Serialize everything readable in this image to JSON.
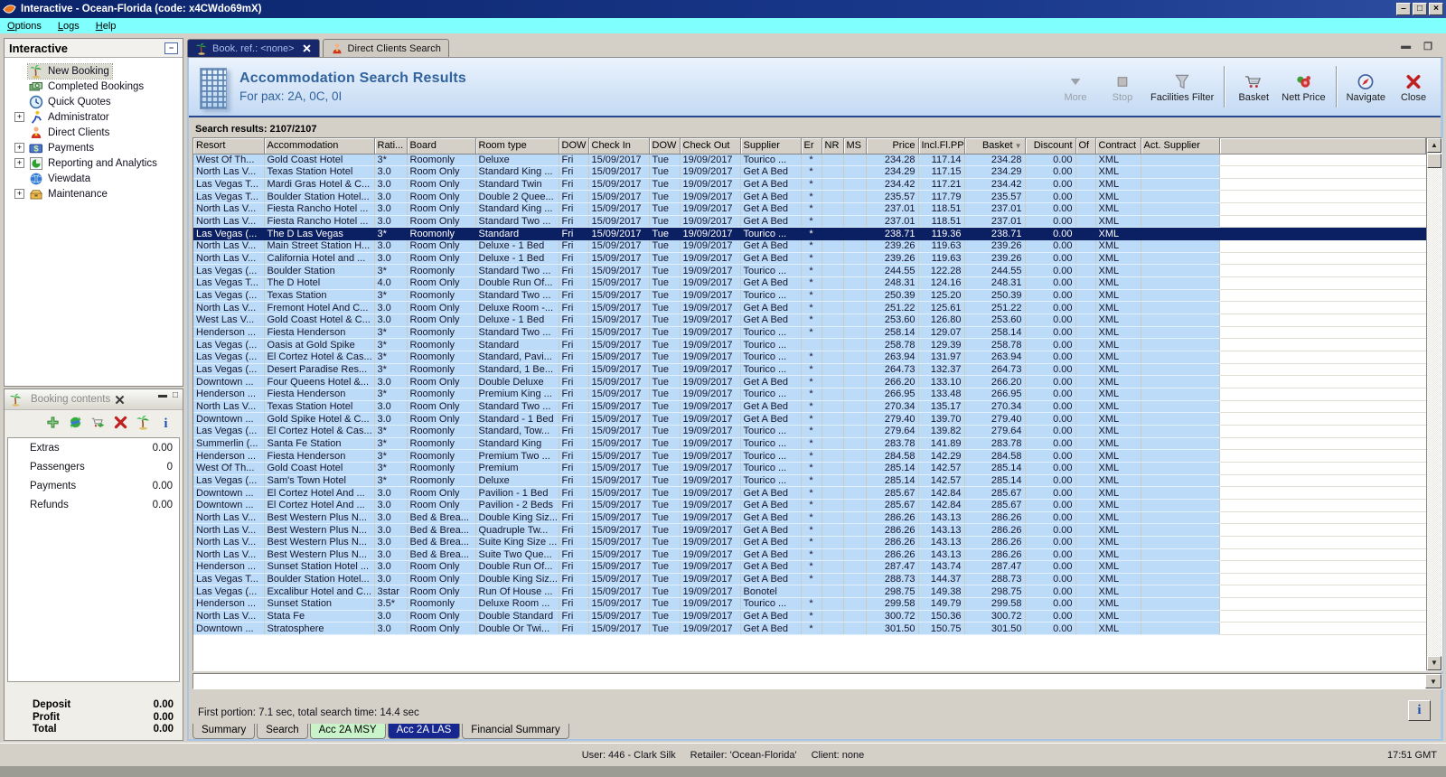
{
  "app": {
    "title": "Interactive - Ocean-Florida (code: x4CWdo69mX)",
    "window_buttons": [
      "minimize",
      "restore",
      "close"
    ]
  },
  "menu": {
    "items": [
      "Options",
      "Logs",
      "Help"
    ]
  },
  "sidebar": {
    "title": "Interactive",
    "collapse_icon": "collapse",
    "items": [
      {
        "label": "New Booking",
        "icon": "palm",
        "expander": false,
        "selected": true
      },
      {
        "label": "Completed Bookings",
        "icon": "money",
        "expander": false
      },
      {
        "label": "Quick Quotes",
        "icon": "clock",
        "expander": false
      },
      {
        "label": "Administrator",
        "icon": "runner",
        "expander": true
      },
      {
        "label": "Direct Clients",
        "icon": "person",
        "expander": false
      },
      {
        "label": "Payments",
        "icon": "payments",
        "expander": true
      },
      {
        "label": "Reporting and Analytics",
        "icon": "report",
        "expander": true
      },
      {
        "label": "Viewdata",
        "icon": "globe",
        "expander": false
      },
      {
        "label": "Maintenance",
        "icon": "maintenance",
        "expander": true
      }
    ]
  },
  "booking_contents": {
    "title": "Booking contents",
    "toolbar_icons": [
      {
        "name": "add-item-icon",
        "icon": "plus"
      },
      {
        "name": "refresh-icon",
        "icon": "refresh"
      },
      {
        "name": "add-to-basket-icon",
        "icon": "basket-add"
      },
      {
        "name": "delete-icon",
        "icon": "close-x"
      },
      {
        "name": "new-booking-icon",
        "icon": "palm"
      },
      {
        "name": "info-icon",
        "icon": "info"
      }
    ],
    "items": [
      {
        "label": "Extras",
        "value": "0.00"
      },
      {
        "label": "Passengers",
        "value": "0"
      },
      {
        "label": "Payments",
        "value": "0.00"
      },
      {
        "label": "Refunds",
        "value": "0.00"
      }
    ],
    "summary": [
      {
        "label": "Deposit",
        "value": "0.00"
      },
      {
        "label": "Profit",
        "value": "0.00"
      },
      {
        "label": "Total",
        "value": "0.00"
      }
    ]
  },
  "tabs": [
    {
      "label": "Book. ref.: <none>",
      "icon": "palm",
      "active": true,
      "closable": true
    },
    {
      "label": "Direct Clients Search",
      "icon": "person",
      "active": false,
      "closable": false
    }
  ],
  "page_header": {
    "icon": "building",
    "title": "Accommodation Search Results",
    "subtitle": "For pax: 2A, 0C, 0I"
  },
  "toolbar": {
    "groups": [
      [
        {
          "label": "More",
          "icon": "more",
          "disabled": true
        },
        {
          "label": "Stop",
          "icon": "stop",
          "disabled": true
        },
        {
          "label": "Facilities Filter",
          "icon": "funnel",
          "disabled": false
        }
      ],
      [
        {
          "label": "Basket",
          "icon": "cart",
          "disabled": false
        },
        {
          "label": "Nett Price",
          "icon": "nett",
          "disabled": false
        }
      ],
      [
        {
          "label": "Navigate",
          "icon": "compass",
          "disabled": false
        },
        {
          "label": "Close",
          "icon": "close-x",
          "disabled": false
        }
      ]
    ]
  },
  "results_label": "Search results: 2107/2107",
  "table": {
    "columns": [
      "Resort",
      "Accommodation",
      "Rati...",
      "Board",
      "Room type",
      "DOW",
      "Check In",
      "DOW",
      "Check Out",
      "Supplier",
      "Er",
      "NR",
      "MS",
      "Price",
      "Incl.Fl.PP",
      "Basket",
      "Discount",
      "Of",
      "Contract",
      "Act. Supplier"
    ],
    "sort_column": "Basket",
    "selected_row": 6,
    "rows": [
      [
        "West Of Th...",
        "Gold Coast Hotel",
        "3*",
        "Roomonly",
        "Deluxe",
        "Fri",
        "15/09/2017",
        "Tue",
        "19/09/2017",
        "Tourico ...",
        "*",
        "",
        "",
        "234.28",
        "117.14",
        "234.28",
        "0.00",
        "",
        "XML",
        ""
      ],
      [
        "North Las V...",
        "Texas Station Hotel",
        "3.0",
        "Room Only",
        "Standard King ...",
        "Fri",
        "15/09/2017",
        "Tue",
        "19/09/2017",
        "Get A Bed",
        "*",
        "",
        "",
        "234.29",
        "117.15",
        "234.29",
        "0.00",
        "",
        "XML",
        ""
      ],
      [
        "Las Vegas T...",
        "Mardi Gras Hotel & C...",
        "3.0",
        "Room Only",
        "Standard Twin",
        "Fri",
        "15/09/2017",
        "Tue",
        "19/09/2017",
        "Get A Bed",
        "*",
        "",
        "",
        "234.42",
        "117.21",
        "234.42",
        "0.00",
        "",
        "XML",
        ""
      ],
      [
        "Las Vegas T...",
        "Boulder Station Hotel...",
        "3.0",
        "Room Only",
        "Double 2 Quee...",
        "Fri",
        "15/09/2017",
        "Tue",
        "19/09/2017",
        "Get A Bed",
        "*",
        "",
        "",
        "235.57",
        "117.79",
        "235.57",
        "0.00",
        "",
        "XML",
        ""
      ],
      [
        "North Las V...",
        "Fiesta Rancho Hotel ...",
        "3.0",
        "Room Only",
        "Standard King ...",
        "Fri",
        "15/09/2017",
        "Tue",
        "19/09/2017",
        "Get A Bed",
        "*",
        "",
        "",
        "237.01",
        "118.51",
        "237.01",
        "0.00",
        "",
        "XML",
        ""
      ],
      [
        "North Las V...",
        "Fiesta Rancho Hotel ...",
        "3.0",
        "Room Only",
        "Standard Two ...",
        "Fri",
        "15/09/2017",
        "Tue",
        "19/09/2017",
        "Get A Bed",
        "*",
        "",
        "",
        "237.01",
        "118.51",
        "237.01",
        "0.00",
        "",
        "XML",
        ""
      ],
      [
        "Las Vegas (...",
        "The D Las Vegas",
        "3*",
        "Roomonly",
        "Standard",
        "Fri",
        "15/09/2017",
        "Tue",
        "19/09/2017",
        "Tourico ...",
        "*",
        "",
        "",
        "238.71",
        "119.36",
        "238.71",
        "0.00",
        "",
        "XML",
        ""
      ],
      [
        "North Las V...",
        "Main Street Station H...",
        "3.0",
        "Room Only",
        "Deluxe - 1 Bed",
        "Fri",
        "15/09/2017",
        "Tue",
        "19/09/2017",
        "Get A Bed",
        "*",
        "",
        "",
        "239.26",
        "119.63",
        "239.26",
        "0.00",
        "",
        "XML",
        ""
      ],
      [
        "North Las V...",
        "California Hotel and ...",
        "3.0",
        "Room Only",
        "Deluxe - 1 Bed",
        "Fri",
        "15/09/2017",
        "Tue",
        "19/09/2017",
        "Get A Bed",
        "*",
        "",
        "",
        "239.26",
        "119.63",
        "239.26",
        "0.00",
        "",
        "XML",
        ""
      ],
      [
        "Las Vegas (...",
        "Boulder Station",
        "3*",
        "Roomonly",
        "Standard Two ...",
        "Fri",
        "15/09/2017",
        "Tue",
        "19/09/2017",
        "Tourico ...",
        "*",
        "",
        "",
        "244.55",
        "122.28",
        "244.55",
        "0.00",
        "",
        "XML",
        ""
      ],
      [
        "Las Vegas T...",
        "The D Hotel",
        "4.0",
        "Room Only",
        "Double Run Of...",
        "Fri",
        "15/09/2017",
        "Tue",
        "19/09/2017",
        "Get A Bed",
        "*",
        "",
        "",
        "248.31",
        "124.16",
        "248.31",
        "0.00",
        "",
        "XML",
        ""
      ],
      [
        "Las Vegas (...",
        "Texas Station",
        "3*",
        "Roomonly",
        "Standard Two ...",
        "Fri",
        "15/09/2017",
        "Tue",
        "19/09/2017",
        "Tourico ...",
        "*",
        "",
        "",
        "250.39",
        "125.20",
        "250.39",
        "0.00",
        "",
        "XML",
        ""
      ],
      [
        "North Las V...",
        "Fremont Hotel And C...",
        "3.0",
        "Room Only",
        "Deluxe Room -...",
        "Fri",
        "15/09/2017",
        "Tue",
        "19/09/2017",
        "Get A Bed",
        "*",
        "",
        "",
        "251.22",
        "125.61",
        "251.22",
        "0.00",
        "",
        "XML",
        ""
      ],
      [
        "West Las V...",
        "Gold Coast Hotel & C...",
        "3.0",
        "Room Only",
        "Deluxe - 1 Bed",
        "Fri",
        "15/09/2017",
        "Tue",
        "19/09/2017",
        "Get A Bed",
        "*",
        "",
        "",
        "253.60",
        "126.80",
        "253.60",
        "0.00",
        "",
        "XML",
        ""
      ],
      [
        "Henderson ...",
        "Fiesta Henderson",
        "3*",
        "Roomonly",
        "Standard Two ...",
        "Fri",
        "15/09/2017",
        "Tue",
        "19/09/2017",
        "Tourico ...",
        "*",
        "",
        "",
        "258.14",
        "129.07",
        "258.14",
        "0.00",
        "",
        "XML",
        ""
      ],
      [
        "Las Vegas (...",
        "Oasis at Gold Spike",
        "3*",
        "Roomonly",
        "Standard",
        "Fri",
        "15/09/2017",
        "Tue",
        "19/09/2017",
        "Tourico ...",
        "",
        "",
        "",
        "258.78",
        "129.39",
        "258.78",
        "0.00",
        "",
        "XML",
        ""
      ],
      [
        "Las Vegas (...",
        "El Cortez Hotel & Cas...",
        "3*",
        "Roomonly",
        "Standard, Pavi...",
        "Fri",
        "15/09/2017",
        "Tue",
        "19/09/2017",
        "Tourico ...",
        "*",
        "",
        "",
        "263.94",
        "131.97",
        "263.94",
        "0.00",
        "",
        "XML",
        ""
      ],
      [
        "Las Vegas (...",
        "Desert Paradise Res...",
        "3*",
        "Roomonly",
        "Standard, 1 Be...",
        "Fri",
        "15/09/2017",
        "Tue",
        "19/09/2017",
        "Tourico ...",
        "*",
        "",
        "",
        "264.73",
        "132.37",
        "264.73",
        "0.00",
        "",
        "XML",
        ""
      ],
      [
        "Downtown ...",
        "Four Queens Hotel &...",
        "3.0",
        "Room Only",
        "Double Deluxe",
        "Fri",
        "15/09/2017",
        "Tue",
        "19/09/2017",
        "Get A Bed",
        "*",
        "",
        "",
        "266.20",
        "133.10",
        "266.20",
        "0.00",
        "",
        "XML",
        ""
      ],
      [
        "Henderson ...",
        "Fiesta Henderson",
        "3*",
        "Roomonly",
        "Premium King ...",
        "Fri",
        "15/09/2017",
        "Tue",
        "19/09/2017",
        "Tourico ...",
        "*",
        "",
        "",
        "266.95",
        "133.48",
        "266.95",
        "0.00",
        "",
        "XML",
        ""
      ],
      [
        "North Las V...",
        "Texas Station Hotel",
        "3.0",
        "Room Only",
        "Standard Two ...",
        "Fri",
        "15/09/2017",
        "Tue",
        "19/09/2017",
        "Get A Bed",
        "*",
        "",
        "",
        "270.34",
        "135.17",
        "270.34",
        "0.00",
        "",
        "XML",
        ""
      ],
      [
        "Downtown ...",
        "Gold Spike Hotel & C...",
        "3.0",
        "Room Only",
        "Standard - 1 Bed",
        "Fri",
        "15/09/2017",
        "Tue",
        "19/09/2017",
        "Get A Bed",
        "*",
        "",
        "",
        "279.40",
        "139.70",
        "279.40",
        "0.00",
        "",
        "XML",
        ""
      ],
      [
        "Las Vegas (...",
        "El Cortez Hotel & Cas...",
        "3*",
        "Roomonly",
        "Standard, Tow...",
        "Fri",
        "15/09/2017",
        "Tue",
        "19/09/2017",
        "Tourico ...",
        "*",
        "",
        "",
        "279.64",
        "139.82",
        "279.64",
        "0.00",
        "",
        "XML",
        ""
      ],
      [
        "Summerlin (...",
        "Santa Fe Station",
        "3*",
        "Roomonly",
        "Standard King",
        "Fri",
        "15/09/2017",
        "Tue",
        "19/09/2017",
        "Tourico ...",
        "*",
        "",
        "",
        "283.78",
        "141.89",
        "283.78",
        "0.00",
        "",
        "XML",
        ""
      ],
      [
        "Henderson ...",
        "Fiesta Henderson",
        "3*",
        "Roomonly",
        "Premium Two ...",
        "Fri",
        "15/09/2017",
        "Tue",
        "19/09/2017",
        "Tourico ...",
        "*",
        "",
        "",
        "284.58",
        "142.29",
        "284.58",
        "0.00",
        "",
        "XML",
        ""
      ],
      [
        "West Of Th...",
        "Gold Coast Hotel",
        "3*",
        "Roomonly",
        "Premium",
        "Fri",
        "15/09/2017",
        "Tue",
        "19/09/2017",
        "Tourico ...",
        "*",
        "",
        "",
        "285.14",
        "142.57",
        "285.14",
        "0.00",
        "",
        "XML",
        ""
      ],
      [
        "Las Vegas (...",
        "Sam's Town Hotel",
        "3*",
        "Roomonly",
        "Deluxe",
        "Fri",
        "15/09/2017",
        "Tue",
        "19/09/2017",
        "Tourico ...",
        "*",
        "",
        "",
        "285.14",
        "142.57",
        "285.14",
        "0.00",
        "",
        "XML",
        ""
      ],
      [
        "Downtown ...",
        "El Cortez Hotel And ...",
        "3.0",
        "Room Only",
        "Pavilion - 1 Bed",
        "Fri",
        "15/09/2017",
        "Tue",
        "19/09/2017",
        "Get A Bed",
        "*",
        "",
        "",
        "285.67",
        "142.84",
        "285.67",
        "0.00",
        "",
        "XML",
        ""
      ],
      [
        "Downtown ...",
        "El Cortez Hotel And ...",
        "3.0",
        "Room Only",
        "Pavilion - 2 Beds",
        "Fri",
        "15/09/2017",
        "Tue",
        "19/09/2017",
        "Get A Bed",
        "*",
        "",
        "",
        "285.67",
        "142.84",
        "285.67",
        "0.00",
        "",
        "XML",
        ""
      ],
      [
        "North Las V...",
        "Best Western Plus N...",
        "3.0",
        "Bed & Brea...",
        "Double King Siz...",
        "Fri",
        "15/09/2017",
        "Tue",
        "19/09/2017",
        "Get A Bed",
        "*",
        "",
        "",
        "286.26",
        "143.13",
        "286.26",
        "0.00",
        "",
        "XML",
        ""
      ],
      [
        "North Las V...",
        "Best Western Plus N...",
        "3.0",
        "Bed & Brea...",
        "Quadruple Tw...",
        "Fri",
        "15/09/2017",
        "Tue",
        "19/09/2017",
        "Get A Bed",
        "*",
        "",
        "",
        "286.26",
        "143.13",
        "286.26",
        "0.00",
        "",
        "XML",
        ""
      ],
      [
        "North Las V...",
        "Best Western Plus N...",
        "3.0",
        "Bed & Brea...",
        "Suite King Size ...",
        "Fri",
        "15/09/2017",
        "Tue",
        "19/09/2017",
        "Get A Bed",
        "*",
        "",
        "",
        "286.26",
        "143.13",
        "286.26",
        "0.00",
        "",
        "XML",
        ""
      ],
      [
        "North Las V...",
        "Best Western Plus N...",
        "3.0",
        "Bed & Brea...",
        "Suite Two Que...",
        "Fri",
        "15/09/2017",
        "Tue",
        "19/09/2017",
        "Get A Bed",
        "*",
        "",
        "",
        "286.26",
        "143.13",
        "286.26",
        "0.00",
        "",
        "XML",
        ""
      ],
      [
        "Henderson ...",
        "Sunset Station Hotel ...",
        "3.0",
        "Room Only",
        "Double Run Of...",
        "Fri",
        "15/09/2017",
        "Tue",
        "19/09/2017",
        "Get A Bed",
        "*",
        "",
        "",
        "287.47",
        "143.74",
        "287.47",
        "0.00",
        "",
        "XML",
        ""
      ],
      [
        "Las Vegas T...",
        "Boulder Station Hotel...",
        "3.0",
        "Room Only",
        "Double King Siz...",
        "Fri",
        "15/09/2017",
        "Tue",
        "19/09/2017",
        "Get A Bed",
        "*",
        "",
        "",
        "288.73",
        "144.37",
        "288.73",
        "0.00",
        "",
        "XML",
        ""
      ],
      [
        "Las Vegas (...",
        "Excalibur Hotel and C...",
        "3star",
        "Room Only",
        "Run Of House ...",
        "Fri",
        "15/09/2017",
        "Tue",
        "19/09/2017",
        "Bonotel",
        "",
        "",
        "",
        "298.75",
        "149.38",
        "298.75",
        "0.00",
        "",
        "XML",
        ""
      ],
      [
        "Henderson ...",
        "Sunset Station",
        "3.5*",
        "Roomonly",
        "Deluxe Room ...",
        "Fri",
        "15/09/2017",
        "Tue",
        "19/09/2017",
        "Tourico ...",
        "*",
        "",
        "",
        "299.58",
        "149.79",
        "299.58",
        "0.00",
        "",
        "XML",
        ""
      ],
      [
        "North Las V...",
        "Stata Fe",
        "3.0",
        "Room Only",
        "Double Standard",
        "Fri",
        "15/09/2017",
        "Tue",
        "19/09/2017",
        "Get A Bed",
        "*",
        "",
        "",
        "300.72",
        "150.36",
        "300.72",
        "0.00",
        "",
        "XML",
        ""
      ],
      [
        "Downtown ...",
        "Stratosphere",
        "3.0",
        "Room Only",
        "Double Or Twi...",
        "Fri",
        "15/09/2017",
        "Tue",
        "19/09/2017",
        "Get A Bed",
        "*",
        "",
        "",
        "301.50",
        "150.75",
        "301.50",
        "0.00",
        "",
        "XML",
        ""
      ]
    ]
  },
  "status_line": "First portion: 7.1 sec, total search time: 14.4 sec",
  "info_button": "i",
  "bottom_tabs": [
    {
      "label": "Summary",
      "variant": "default"
    },
    {
      "label": "Search",
      "variant": "default"
    },
    {
      "label": "Acc 2A MSY",
      "variant": "green"
    },
    {
      "label": "Acc 2A LAS",
      "variant": "selected"
    },
    {
      "label": "Financial Summary",
      "variant": "default"
    }
  ],
  "status_bar": {
    "user": "User: 446 - Clark Silk",
    "retailer": "Retailer: 'Ocean-Florida'",
    "client": "Client: none",
    "time": "17:51 GMT"
  }
}
